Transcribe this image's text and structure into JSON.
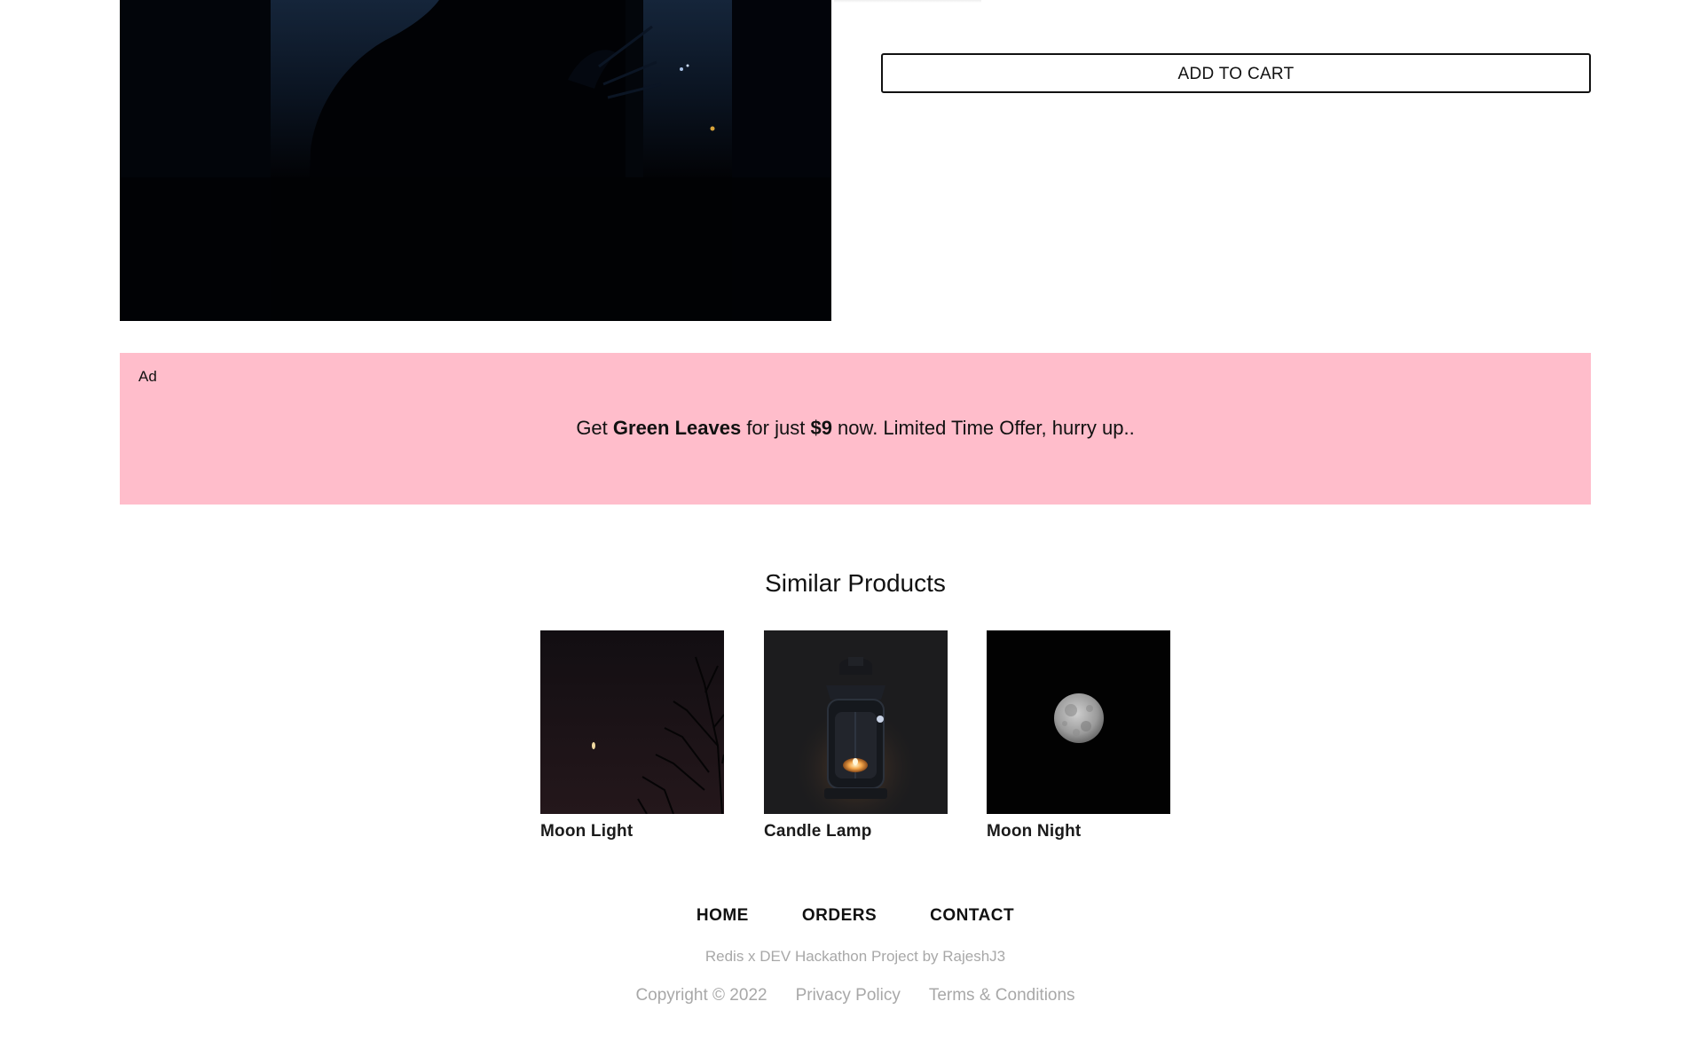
{
  "product": {
    "add_to_cart_label": "ADD TO CART"
  },
  "ad": {
    "label": "Ad",
    "text_prefix": "Get ",
    "product_name": "Green Leaves",
    "text_middle": " for just ",
    "price": "$9",
    "text_suffix": " now. Limited Time Offer, hurry up..",
    "background_color": "#ffbdcb"
  },
  "similar": {
    "title": "Similar Products",
    "items": [
      {
        "name": "Moon Light"
      },
      {
        "name": "Candle Lamp"
      },
      {
        "name": "Moon Night"
      }
    ]
  },
  "footer": {
    "nav": [
      "HOME",
      "ORDERS",
      "CONTACT"
    ],
    "credit": "Redis x DEV Hackathon Project by RajeshJ3",
    "copyright": "Copyright © 2022",
    "privacy": "Privacy Policy",
    "terms": "Terms & Conditions"
  }
}
